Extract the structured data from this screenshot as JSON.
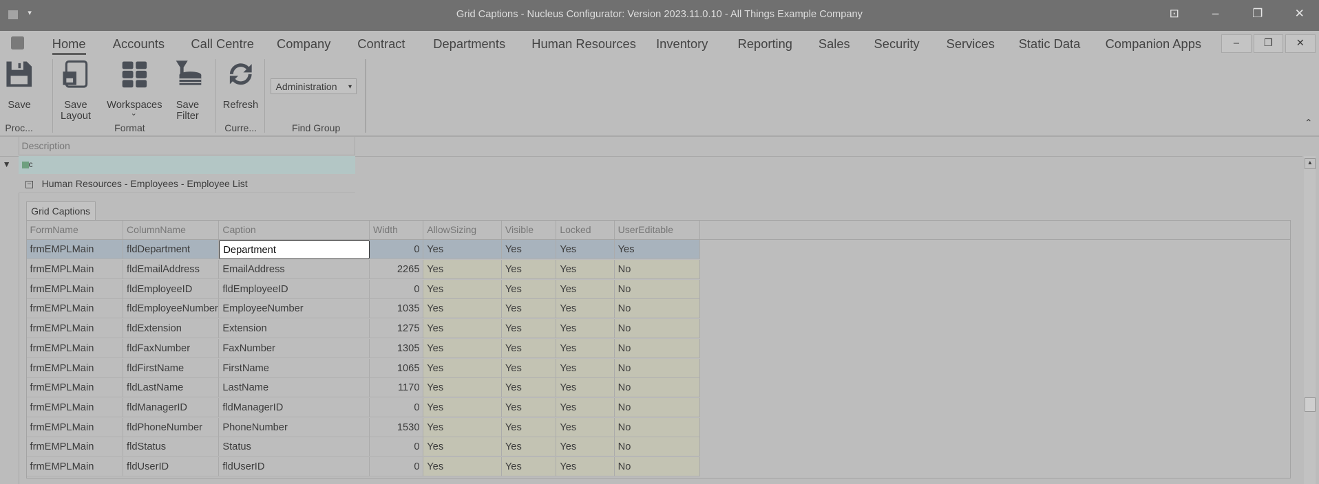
{
  "window": {
    "title": "Grid Captions - Nucleus Configurator: Version 2023.11.0.10 - All Things Example Company"
  },
  "menu_tabs": [
    "Home",
    "Accounts",
    "Call Centre",
    "Company",
    "Contract",
    "Departments",
    "Human Resources",
    "Inventory",
    "Reporting",
    "Sales",
    "Security",
    "Services",
    "Static Data",
    "Companion Apps"
  ],
  "ribbon": {
    "save": "Save",
    "save_layout": "Save Layout",
    "workspaces": "Workspaces",
    "save_filter": "Save Filter",
    "refresh": "Refresh",
    "find_group_value": "Administration",
    "groups": {
      "proc": "Proc...",
      "format": "Format",
      "curre": "Curre...",
      "find_group": "Find Group"
    }
  },
  "outer_grid": {
    "column": "Description",
    "filter_text": "c",
    "group_row": "Human Resources - Employees - Employee List"
  },
  "detail": {
    "tab": "Grid Captions",
    "columns": [
      "FormName",
      "ColumnName",
      "Caption",
      "Width",
      "AllowSizing",
      "Visible",
      "Locked",
      "UserEditable"
    ],
    "rows": [
      [
        "frmEMPLMain",
        "fldDepartment",
        "Department",
        "0",
        "Yes",
        "Yes",
        "Yes",
        "Yes"
      ],
      [
        "frmEMPLMain",
        "fldEmailAddress",
        "EmailAddress",
        "2265",
        "Yes",
        "Yes",
        "Yes",
        "No"
      ],
      [
        "frmEMPLMain",
        "fldEmployeeID",
        "fldEmployeeID",
        "0",
        "Yes",
        "Yes",
        "Yes",
        "No"
      ],
      [
        "frmEMPLMain",
        "fldEmployeeNumber",
        "EmployeeNumber",
        "1035",
        "Yes",
        "Yes",
        "Yes",
        "No"
      ],
      [
        "frmEMPLMain",
        "fldExtension",
        "Extension",
        "1275",
        "Yes",
        "Yes",
        "Yes",
        "No"
      ],
      [
        "frmEMPLMain",
        "fldFaxNumber",
        "FaxNumber",
        "1305",
        "Yes",
        "Yes",
        "Yes",
        "No"
      ],
      [
        "frmEMPLMain",
        "fldFirstName",
        "FirstName",
        "1065",
        "Yes",
        "Yes",
        "Yes",
        "No"
      ],
      [
        "frmEMPLMain",
        "fldLastName",
        "LastName",
        "1170",
        "Yes",
        "Yes",
        "Yes",
        "No"
      ],
      [
        "frmEMPLMain",
        "fldManagerID",
        "fldManagerID",
        "0",
        "Yes",
        "Yes",
        "Yes",
        "No"
      ],
      [
        "frmEMPLMain",
        "fldPhoneNumber",
        "PhoneNumber",
        "1530",
        "Yes",
        "Yes",
        "Yes",
        "No"
      ],
      [
        "frmEMPLMain",
        "fldStatus",
        "Status",
        "0",
        "Yes",
        "Yes",
        "Yes",
        "No"
      ],
      [
        "frmEMPLMain",
        "fldUserID",
        "fldUserID",
        "0",
        "Yes",
        "Yes",
        "Yes",
        "No"
      ]
    ]
  }
}
